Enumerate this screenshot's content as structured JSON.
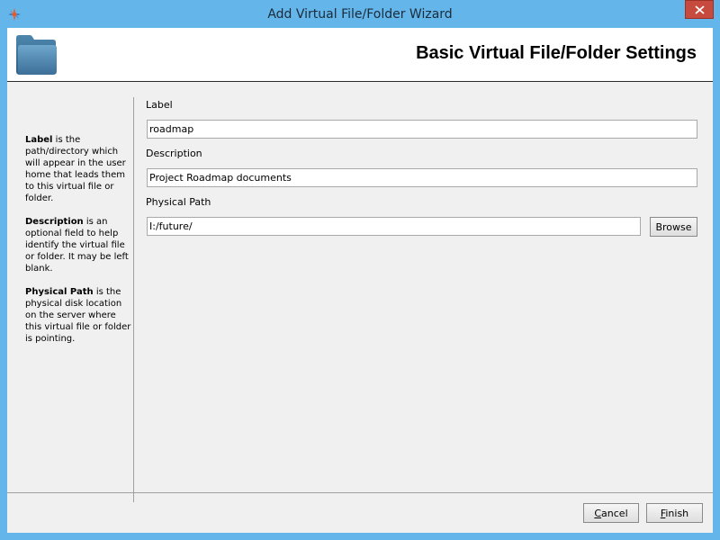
{
  "window": {
    "title": "Add Virtual File/Folder Wizard",
    "app_icon": "app-logo-icon",
    "close_icon": "close-icon",
    "accent_color": "#64b5e9",
    "close_color": "#c74a3f"
  },
  "header": {
    "title": "Basic Virtual File/Folder Settings",
    "icon": "folder-icon"
  },
  "help": {
    "label_term": "Label",
    "label_text": " is the path/directory which will appear in the user home that leads them to this virtual file or folder.",
    "description_term": "Description",
    "description_text": " is an optional field to help identify the virtual file or folder. It may be left blank.",
    "path_term": "Physical Path",
    "path_text": " is the physical disk location on the server where this virtual file or folder is pointing."
  },
  "form": {
    "label_caption": "Label",
    "label_value": "roadmap",
    "description_caption": "Description",
    "description_value": "Project Roadmap documents",
    "path_caption": "Physical Path",
    "path_value": "I:/future/",
    "browse_label": "Browse"
  },
  "footer": {
    "cancel_label": "Cancel",
    "finish_label": "Finish"
  }
}
